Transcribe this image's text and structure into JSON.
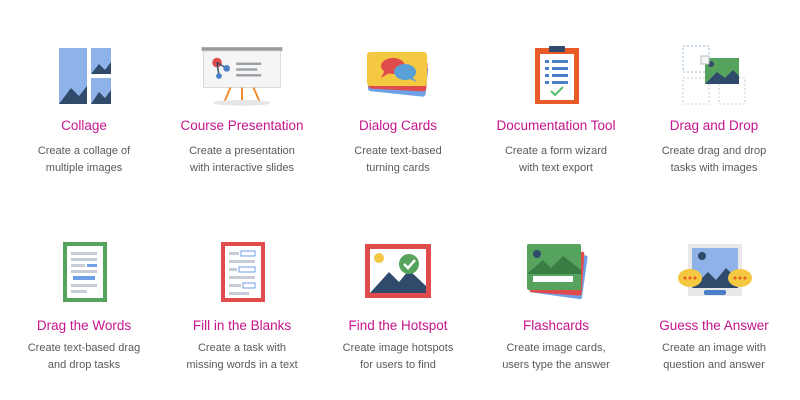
{
  "tiles": [
    {
      "title": "Collage",
      "desc": [
        "Create a collage of",
        "multiple images"
      ],
      "icon": "collage-icon"
    },
    {
      "title": "Course Presentation",
      "desc": [
        "Create a presentation",
        "with interactive slides"
      ],
      "icon": "presentation-board-icon"
    },
    {
      "title": "Dialog Cards",
      "desc": [
        "Create text-based",
        "turning cards"
      ],
      "icon": "dialog-cards-icon"
    },
    {
      "title": "Documentation Tool",
      "desc": [
        "Create a form wizard",
        "with text export"
      ],
      "icon": "clipboard-checklist-icon"
    },
    {
      "title": "Drag and Drop",
      "desc": [
        "Create drag and drop",
        "tasks with images"
      ],
      "icon": "drag-and-drop-icon"
    },
    {
      "title": "Drag the Words",
      "desc": [
        "Create text-based drag",
        "and drop tasks"
      ],
      "icon": "drag-the-words-icon"
    },
    {
      "title": "Fill in the Blanks",
      "desc": [
        "Create a task with",
        "missing words in a text"
      ],
      "icon": "fill-in-blanks-icon"
    },
    {
      "title": "Find the Hotspot",
      "desc": [
        "Create image hotspots",
        "for users to find"
      ],
      "icon": "find-hotspot-icon"
    },
    {
      "title": "Flashcards",
      "desc": [
        "Create image cards,",
        "users type the answer"
      ],
      "icon": "flashcards-icon"
    },
    {
      "title": "Guess the Answer",
      "desc": [
        "Create an image with",
        "question and answer"
      ],
      "icon": "guess-answer-icon"
    }
  ],
  "colors": {
    "title": "#c8148c",
    "desc": "#5a5a5a",
    "blue": "#8fb3e8",
    "navy": "#2f4a6b",
    "green": "#55a35c",
    "red": "#e04b4b",
    "orange": "#f08a2c",
    "yellow": "#f5c842"
  }
}
